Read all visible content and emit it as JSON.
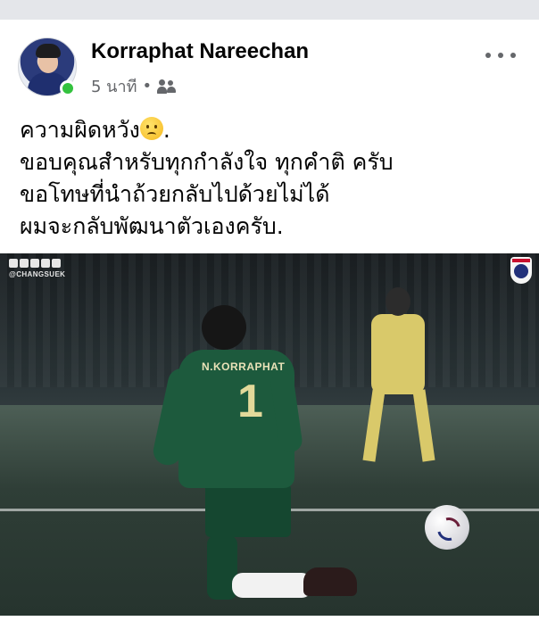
{
  "post": {
    "author": "Korraphat Nareechan",
    "time": "5 นาที",
    "separator": "•",
    "audience_icon": "friends-icon",
    "more_icon": "more-options-icon",
    "caption_lines": [
      "ความผิดหวัง",
      "ขอบคุณสำหรับทุกกำลังใจ ทุกคำติ ครับ",
      "ขอโทษที่นำถ้วยกลับไปด้วยไม่ได้",
      "ผมจะกลับพัฒนาตัวเองครับ."
    ],
    "caption_emoji": "sad-tear-emoji",
    "caption_line1_suffix": "."
  },
  "photo": {
    "watermark_handle": "@CHANGSUEK",
    "jersey_name": "N.KORRAPHAT",
    "jersey_number": "1",
    "crest_icon": "fa-thailand-crest-icon",
    "social_icons": [
      "facebook-icon",
      "instagram-icon",
      "youtube-icon",
      "line-icon",
      "twitter-icon"
    ]
  },
  "colors": {
    "online": "#33c23e",
    "meta_text": "#65676b",
    "top_bar": "#e4e6ea"
  }
}
